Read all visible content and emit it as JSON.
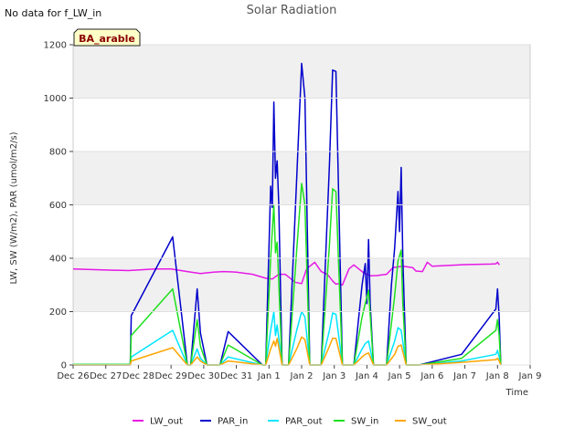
{
  "chart_data": {
    "type": "line",
    "title": "Solar Radiation",
    "notice": "No data for f_LW_in",
    "badge": "BA_arable",
    "xlabel": "Time",
    "ylabel": "LW, SW (W/m2), PAR (umol/m2/s)",
    "xlim": [
      0,
      14
    ],
    "ylim": [
      0,
      1200
    ],
    "xticks": [
      {
        "v": 0,
        "label": "Dec 26"
      },
      {
        "v": 1,
        "label": "Dec 27"
      },
      {
        "v": 2,
        "label": "Dec 28"
      },
      {
        "v": 3,
        "label": "Dec 29"
      },
      {
        "v": 4,
        "label": "Dec 30"
      },
      {
        "v": 5,
        "label": "Dec 31"
      },
      {
        "v": 6,
        "label": "Jan 1"
      },
      {
        "v": 7,
        "label": "Jan 2"
      },
      {
        "v": 8,
        "label": "Jan 3"
      },
      {
        "v": 9,
        "label": "Jan 4"
      },
      {
        "v": 10,
        "label": "Jan 5"
      },
      {
        "v": 11,
        "label": "Jan 6"
      },
      {
        "v": 12,
        "label": "Jan 7"
      },
      {
        "v": 13,
        "label": "Jan 8"
      },
      {
        "v": 14,
        "label": "Jan 9"
      }
    ],
    "yticks": [
      0,
      200,
      400,
      600,
      800,
      1000,
      1200
    ],
    "bands": [
      [
        200,
        400
      ],
      [
        600,
        800
      ],
      [
        1000,
        1200
      ]
    ],
    "band_color": "#f0f0f0",
    "legend_placement": "bottom",
    "series": [
      {
        "name": "LW_out",
        "color": "#e619e6",
        "points": [
          [
            0,
            360
          ],
          [
            1,
            356
          ],
          [
            1.7,
            354
          ],
          [
            2.5,
            360
          ],
          [
            3,
            360
          ],
          [
            3.5,
            350
          ],
          [
            3.9,
            343
          ],
          [
            4.3,
            348
          ],
          [
            4.6,
            350
          ],
          [
            5,
            348
          ],
          [
            5.5,
            340
          ],
          [
            5.9,
            325
          ],
          [
            6.1,
            322
          ],
          [
            6.3,
            340
          ],
          [
            6.5,
            340
          ],
          [
            6.8,
            310
          ],
          [
            7,
            305
          ],
          [
            7.15,
            360
          ],
          [
            7.4,
            385
          ],
          [
            7.6,
            350
          ],
          [
            7.8,
            338
          ],
          [
            7.95,
            315
          ],
          [
            8.05,
            303
          ],
          [
            8.15,
            305
          ],
          [
            8.25,
            300
          ],
          [
            8.45,
            360
          ],
          [
            8.6,
            375
          ],
          [
            8.9,
            345
          ],
          [
            9.1,
            334
          ],
          [
            9.3,
            335
          ],
          [
            9.6,
            340
          ],
          [
            9.8,
            365
          ],
          [
            10.1,
            370
          ],
          [
            10.4,
            365
          ],
          [
            10.5,
            352
          ],
          [
            10.7,
            350
          ],
          [
            10.85,
            385
          ],
          [
            11,
            370
          ],
          [
            12,
            376
          ],
          [
            12.8,
            378
          ],
          [
            12.95,
            379
          ],
          [
            13,
            385
          ],
          [
            13.06,
            375
          ]
        ]
      },
      {
        "name": "PAR_in",
        "color": "#0000cc",
        "points": [
          [
            0,
            0
          ],
          [
            1.75,
            0
          ],
          [
            1.78,
            185
          ],
          [
            3.05,
            480
          ],
          [
            3.5,
            0
          ],
          [
            3.6,
            0
          ],
          [
            3.8,
            285
          ],
          [
            3.9,
            120
          ],
          [
            4.1,
            0
          ],
          [
            4.5,
            0
          ],
          [
            4.75,
            125
          ],
          [
            5.8,
            0
          ],
          [
            5.9,
            0
          ],
          [
            6.05,
            670
          ],
          [
            6.1,
            590
          ],
          [
            6.15,
            985
          ],
          [
            6.2,
            700
          ],
          [
            6.25,
            765
          ],
          [
            6.3,
            600
          ],
          [
            6.4,
            0
          ],
          [
            6.6,
            0
          ],
          [
            6.85,
            700
          ],
          [
            7.0,
            1130
          ],
          [
            7.1,
            1000
          ],
          [
            7.25,
            0
          ],
          [
            7.6,
            0
          ],
          [
            7.85,
            750
          ],
          [
            7.95,
            1105
          ],
          [
            8.05,
            1100
          ],
          [
            8.25,
            0
          ],
          [
            8.6,
            0
          ],
          [
            8.85,
            300
          ],
          [
            8.95,
            380
          ],
          [
            9.0,
            230
          ],
          [
            9.05,
            470
          ],
          [
            9.1,
            230
          ],
          [
            9.2,
            0
          ],
          [
            9.6,
            0
          ],
          [
            9.75,
            300
          ],
          [
            9.85,
            440
          ],
          [
            9.95,
            650
          ],
          [
            10.0,
            500
          ],
          [
            10.05,
            740
          ],
          [
            10.1,
            400
          ],
          [
            10.2,
            0
          ],
          [
            10.6,
            0
          ],
          [
            11.9,
            40
          ],
          [
            12.95,
            210
          ],
          [
            13.0,
            285
          ],
          [
            13.05,
            180
          ],
          [
            13.1,
            0
          ]
        ]
      },
      {
        "name": "PAR_out",
        "color": "#00e5ff",
        "points": [
          [
            0,
            2
          ],
          [
            1.75,
            2
          ],
          [
            1.78,
            30
          ],
          [
            3.05,
            130
          ],
          [
            3.5,
            0
          ],
          [
            3.6,
            0
          ],
          [
            3.8,
            60
          ],
          [
            3.9,
            25
          ],
          [
            4.1,
            0
          ],
          [
            4.5,
            0
          ],
          [
            4.75,
            30
          ],
          [
            5.8,
            0
          ],
          [
            5.9,
            0
          ],
          [
            6.05,
            130
          ],
          [
            6.15,
            200
          ],
          [
            6.2,
            110
          ],
          [
            6.25,
            150
          ],
          [
            6.4,
            0
          ],
          [
            6.6,
            0
          ],
          [
            6.85,
            130
          ],
          [
            7.0,
            200
          ],
          [
            7.1,
            180
          ],
          [
            7.25,
            0
          ],
          [
            7.6,
            0
          ],
          [
            7.85,
            130
          ],
          [
            7.95,
            195
          ],
          [
            8.05,
            190
          ],
          [
            8.25,
            0
          ],
          [
            8.6,
            0
          ],
          [
            8.85,
            60
          ],
          [
            8.95,
            80
          ],
          [
            9.05,
            90
          ],
          [
            9.2,
            0
          ],
          [
            9.6,
            0
          ],
          [
            9.85,
            90
          ],
          [
            9.95,
            140
          ],
          [
            10.05,
            130
          ],
          [
            10.2,
            0
          ],
          [
            10.6,
            0
          ],
          [
            11.9,
            15
          ],
          [
            12.95,
            40
          ],
          [
            13.0,
            55
          ],
          [
            13.05,
            30
          ],
          [
            13.1,
            0
          ]
        ]
      },
      {
        "name": "SW_in",
        "color": "#1ee01e",
        "points": [
          [
            0,
            2
          ],
          [
            1.75,
            2
          ],
          [
            1.78,
            110
          ],
          [
            3.05,
            285
          ],
          [
            3.5,
            0
          ],
          [
            3.6,
            0
          ],
          [
            3.8,
            170
          ],
          [
            3.9,
            70
          ],
          [
            4.1,
            0
          ],
          [
            4.5,
            0
          ],
          [
            4.75,
            75
          ],
          [
            5.8,
            0
          ],
          [
            5.9,
            0
          ],
          [
            6.05,
            400
          ],
          [
            6.15,
            600
          ],
          [
            6.2,
            420
          ],
          [
            6.25,
            460
          ],
          [
            6.4,
            0
          ],
          [
            6.6,
            0
          ],
          [
            6.85,
            430
          ],
          [
            7.0,
            680
          ],
          [
            7.1,
            600
          ],
          [
            7.25,
            0
          ],
          [
            7.6,
            0
          ],
          [
            7.85,
            450
          ],
          [
            7.95,
            660
          ],
          [
            8.05,
            650
          ],
          [
            8.25,
            0
          ],
          [
            8.6,
            0
          ],
          [
            8.85,
            180
          ],
          [
            8.95,
            230
          ],
          [
            9.05,
            280
          ],
          [
            9.2,
            0
          ],
          [
            9.6,
            0
          ],
          [
            9.85,
            260
          ],
          [
            9.95,
            390
          ],
          [
            10.05,
            430
          ],
          [
            10.1,
            230
          ],
          [
            10.2,
            0
          ],
          [
            10.6,
            0
          ],
          [
            11.9,
            25
          ],
          [
            12.95,
            130
          ],
          [
            13.0,
            170
          ],
          [
            13.05,
            110
          ],
          [
            13.1,
            0
          ]
        ]
      },
      {
        "name": "SW_out",
        "color": "#ffa500",
        "points": [
          [
            0,
            0
          ],
          [
            1.75,
            0
          ],
          [
            1.78,
            15
          ],
          [
            3.05,
            65
          ],
          [
            3.5,
            0
          ],
          [
            3.6,
            0
          ],
          [
            3.8,
            30
          ],
          [
            3.9,
            15
          ],
          [
            4.1,
            0
          ],
          [
            4.5,
            0
          ],
          [
            4.75,
            15
          ],
          [
            5.8,
            0
          ],
          [
            5.9,
            0
          ],
          [
            6.05,
            60
          ],
          [
            6.15,
            90
          ],
          [
            6.2,
            70
          ],
          [
            6.25,
            100
          ],
          [
            6.4,
            0
          ],
          [
            6.6,
            0
          ],
          [
            6.85,
            60
          ],
          [
            7.0,
            105
          ],
          [
            7.1,
            95
          ],
          [
            7.25,
            0
          ],
          [
            7.6,
            0
          ],
          [
            7.85,
            70
          ],
          [
            7.95,
            100
          ],
          [
            8.05,
            100
          ],
          [
            8.25,
            0
          ],
          [
            8.6,
            0
          ],
          [
            8.85,
            30
          ],
          [
            8.95,
            40
          ],
          [
            9.05,
            45
          ],
          [
            9.2,
            0
          ],
          [
            9.6,
            0
          ],
          [
            9.85,
            40
          ],
          [
            9.95,
            70
          ],
          [
            10.05,
            75
          ],
          [
            10.2,
            0
          ],
          [
            10.6,
            0
          ],
          [
            11.9,
            10
          ],
          [
            12.95,
            20
          ],
          [
            13.0,
            25
          ],
          [
            13.05,
            15
          ],
          [
            13.1,
            0
          ]
        ]
      }
    ]
  }
}
